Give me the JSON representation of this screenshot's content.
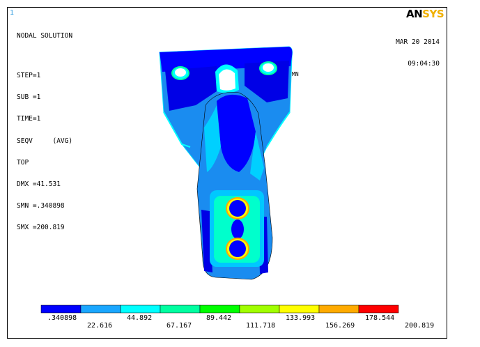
{
  "window": {
    "number": "1"
  },
  "info": {
    "title": "NODAL SOLUTION",
    "lines": [
      "STEP=1",
      "SUB =1",
      "TIME=1",
      "SEQV     (AVG)",
      "TOP",
      "DMX =41.531",
      "SMN =.340898",
      "SMX =200.819"
    ]
  },
  "datetime": {
    "date": "MAR 20 2014",
    "time": "09:04:30"
  },
  "logo": {
    "left": "AN",
    "right": "SYS"
  },
  "model": {
    "mn_marker": "MN"
  },
  "legend": {
    "colors": [
      "#0000ff",
      "#1aa6ff",
      "#00ffff",
      "#00ffa0",
      "#00ff00",
      "#a0ff00",
      "#ffff00",
      "#ffaa00",
      "#ff0000"
    ],
    "top_labels": [
      ".340898",
      "44.892",
      "89.442",
      "133.993",
      "178.544"
    ],
    "bottom_labels": [
      "22.616",
      "67.167",
      "111.718",
      "156.269",
      "200.819"
    ]
  }
}
